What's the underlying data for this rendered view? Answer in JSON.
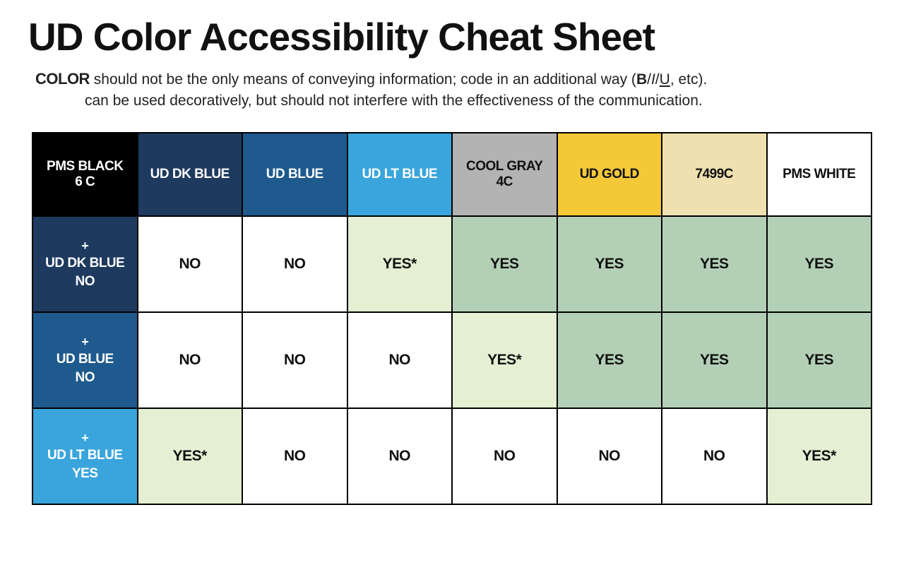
{
  "title": "UD Color Accessibility Cheat Sheet",
  "intro": {
    "lead": "COLOR",
    "line1_rest": " should not be the only means of conveying information; code in an additional way (",
    "b": "B",
    "sep1": "/",
    "i": "I",
    "sep2": "/",
    "u": "U",
    "line1_tail": ", etc).",
    "line2": "can be used decoratively, but should not interfere with the effectiveness of the communication."
  },
  "colors": {
    "black": "#000000",
    "dkblue": "#1e3a5f",
    "blue": "#1e5a8e",
    "ltblue": "#3aa5dc",
    "gray": "#b3b3b3",
    "gold": "#f5c838",
    "cream": "#efe0b0",
    "white": "#ffffff",
    "cell_no": "#ffffff",
    "cell_yesstar": "#e4efd3",
    "cell_yes": "#b3d0b7"
  },
  "columns": [
    {
      "label": "PMS BLACK 6 C",
      "bg": "black"
    },
    {
      "label": "UD DK BLUE",
      "bg": "dkblue"
    },
    {
      "label": "UD BLUE",
      "bg": "blue"
    },
    {
      "label": "UD LT BLUE",
      "bg": "ltblue"
    },
    {
      "label": "COOL GRAY 4C",
      "bg": "gray"
    },
    {
      "label": "UD GOLD",
      "bg": "gold"
    },
    {
      "label": "7499C",
      "bg": "cream"
    },
    {
      "label": "PMS WHITE",
      "bg": "white"
    }
  ],
  "rows": [
    {
      "header": {
        "plus": "+",
        "name": "UD DK BLUE",
        "black_combo": "NO",
        "bg": "dkblue"
      },
      "cells": [
        "NO",
        "NO",
        "YES*",
        "YES",
        "YES",
        "YES",
        "YES"
      ]
    },
    {
      "header": {
        "plus": "+",
        "name": "UD BLUE",
        "black_combo": "NO",
        "bg": "blue"
      },
      "cells": [
        "NO",
        "NO",
        "NO",
        "YES*",
        "YES",
        "YES",
        "YES"
      ]
    },
    {
      "header": {
        "plus": "+",
        "name": "UD LT BLUE",
        "black_combo": "YES",
        "bg": "ltblue"
      },
      "cells": [
        "YES*",
        "NO",
        "NO",
        "NO",
        "NO",
        "NO",
        "YES*"
      ]
    }
  ],
  "value_styles": {
    "NO": "v-no",
    "YES": "v-yes",
    "YES*": "v-yesstar"
  }
}
